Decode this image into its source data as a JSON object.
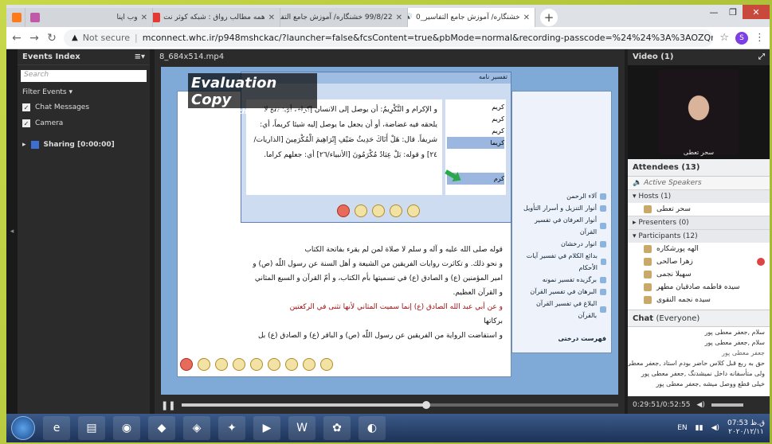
{
  "browser": {
    "tabs": [
      {
        "title": "وب اپنا",
        "color": "#ff7a1a",
        "active": false
      },
      {
        "title": "همه مطالب رواق : شبکه کوثر نت",
        "color": "#c05aa8",
        "active": false
      },
      {
        "title": "99/8/22 خشنگاره/ آموزش جامع التفاسیر",
        "color": "#e53935",
        "active": false
      },
      {
        "title": "خشنگاره/ آموزش جامع التفاسیر_0",
        "color": "#1f7a3a",
        "active": true
      }
    ],
    "new_tab": "+",
    "url_security": "Not secure",
    "url": "mconnect.whc.ir/p948mshckac/?launcher=false&fcsContent=true&pbMode=normal&recording-passcode=%24%24%3A%3AOZQmzNrxb9m6WDUxHCQPhjHpADf...",
    "ext_letter": "S"
  },
  "sidebar": {
    "title": "Events Index",
    "search_placeholder": "Search",
    "filter_label": "Filter Events",
    "checks": [
      {
        "label": "Chat Messages",
        "checked": true
      },
      {
        "label": "Camera",
        "checked": true
      }
    ],
    "sharing_label": "Sharing [0:00:00]"
  },
  "main": {
    "filename": "8_684x514.mp4",
    "time": "0:29:51/0:52:55"
  },
  "video_content": {
    "eval_title": "Evaluation Copy",
    "eval_url": "http://www.thundershare.net",
    "dialog_title": "تفسیر نامه",
    "dialog_text": "و الإكرام و التَّكْرِيمُ: أن يوصل إلى الانسان إكرام، أي: نفع لا يلحقه فيه غضاضة، أو أن يجعل ما يوصل إليه شيئا كريماً، أي: شريفاً. قال: هَلْ أَتَاكَ حَدِيثُ ضَيْفِ إِبْرَاهِيمَ الْمُكْرَمِينَ [الذاريات/٢٤] و قوله: بَلْ عِبَادٌ مُكْرَمُونَ [الأنبياء/٢٦] أي: جعلهم كراما.",
    "dialog_list": [
      "کریم",
      "کریم",
      "کریم",
      "کریما",
      "کرم"
    ],
    "page_lines": [
      "قوله صلى الله عليه و آله و سلم لا صلاة لمن لم يقرء بفاتحة الكتاب",
      "و نحو ذلك. و تكاثرت روايات الفريقين من الشيعة و أهل السنة عن رسول اللّه (ص) و",
      "امير المؤمنين (ع) و الصادق (ع) في تسميتها بأم الكتاب، و أمّ القرآن و السبع المثاني",
      "و القرآن العظيم.",
      "و عن أبي عبد الله الصادق (ع) إنما سميت المثاني لأنها تثنى في الركعتين",
      "بركاتها",
      "و استفاضت الرواية من الفريقين عن رسول اللّه (ص) و الباقر (ع) و الصادق (ع) بل"
    ],
    "toc": [
      "آلاء الرحمن",
      "أنوار التنزيل و أسرار التأويل",
      "أنوار العرفان في تفسير القرآن",
      "انوار درخشان",
      "بدائع الكلام في تفسير آيات الأحكام",
      "برگزیده تفسیر نمونه",
      "البرهان في تفسير القرآن",
      "البلاغ في تفسير القرآن بالقرآن"
    ],
    "toc_tab": "فهرست درختی"
  },
  "right": {
    "video_title": "Video",
    "video_count": "(1)",
    "cam_name": "سحر تعطی",
    "attendees_title": "Attendees",
    "attendees_count": "(13)",
    "active_speakers": "Active Speakers",
    "hosts_label": "Hosts (1)",
    "host": "سحر تعطی",
    "presenters_label": "Presenters (0)",
    "participants_label": "Participants (12)",
    "participants": [
      "الهه پورشکاره",
      "زهرا صالحی",
      "سهیلا نجمی",
      "سیده فاطمه صادقیان مطهر",
      "سیده نجمه النقوی"
    ],
    "chat_title": "Chat",
    "chat_scope": "(Everyone)",
    "chat": [
      {
        "user": "سلام ,جعفر معطی پور",
        "text": ""
      },
      {
        "user": "سلام ,جعفر معطی پور",
        "text": ""
      },
      {
        "user": "جعفر معطی پور",
        "text": "حق به ربع قبل کلاس حاضر بودم استاد ,جعفر معطی پور"
      },
      {
        "user": "",
        "text": "ولی متأسفانه داخل نمیشدنگ ,جعفر معطی پور"
      },
      {
        "user": "",
        "text": "خیلی قطع ووصل میشه ,جعفر معطی پور"
      }
    ]
  },
  "taskbar": {
    "lang": "EN",
    "time": "07:53 ق.ظ",
    "date": "۲۰۲۰/۱۲/۱۱"
  }
}
